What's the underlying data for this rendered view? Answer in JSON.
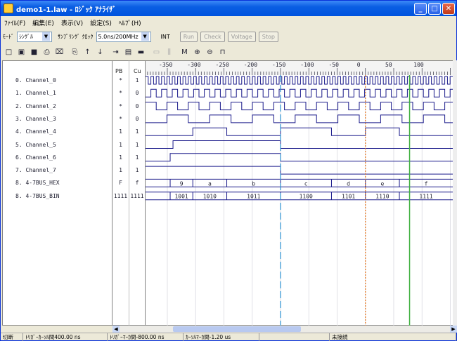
{
  "title": "demo1-1.law - ﾛｼﾞｯｸ ｱﾅﾗｲｻﾞ",
  "window_buttons": {
    "minimize": "_",
    "maximize": "□",
    "close": "✕"
  },
  "menu": [
    "ﾌｧｲﾙ(F)",
    "編集(E)",
    "表示(V)",
    "設定(S)",
    "ﾍﾙﾌﾟ(H)"
  ],
  "modebar": {
    "mode_label": "ﾓｰﾄﾞ",
    "mode_value": "ｼﾝｸﾞﾙ",
    "clock_label": "ｻﾝﾌﾟﾘﾝｸﾞ ｸﾛｯｸ",
    "clock_value": "5.0ns/200MHz",
    "int_label": "INT",
    "run": "Run",
    "check": "Check",
    "voltage": "Voltage",
    "stop": "Stop"
  },
  "toolbar_icons": [
    "new-file",
    "open-folder",
    "save",
    "print",
    "print-preview",
    "copy",
    "arrow-up",
    "arrow-down",
    "jump",
    "bars-chart",
    "red-bar",
    "disabled-1",
    "disabled-2",
    "marker-m",
    "zoom-in",
    "zoom-out",
    "pulse"
  ],
  "toolbar_glyphs": [
    "□",
    "▣",
    "■",
    "⎙",
    "⌧",
    "⎘",
    "↑",
    "↓",
    "⇥",
    "▤",
    "▬",
    "▭",
    "⫼",
    "M",
    "⊕",
    "⊖",
    "⊓"
  ],
  "columns": {
    "pb": "PB",
    "cu": "Cu"
  },
  "ruler_labels": [
    "-350",
    "-300",
    "-250",
    "-200",
    "-150",
    "-100",
    "-50",
    "0",
    "50",
    "100"
  ],
  "ruler_values": [
    -350,
    -300,
    -250,
    -200,
    -150,
    -100,
    -50,
    0,
    50,
    100
  ],
  "channels": [
    {
      "name": "0.  Channel_0",
      "pb": "*",
      "cu": "1"
    },
    {
      "name": "1.  Channel_1",
      "pb": "*",
      "cu": "0"
    },
    {
      "name": "2.  Channel_2",
      "pb": "*",
      "cu": "0"
    },
    {
      "name": "3.  Channel_3",
      "pb": "*",
      "cu": "0"
    },
    {
      "name": "4.  Channel_4",
      "pb": "1",
      "cu": "1"
    },
    {
      "name": "5.  Channel_5",
      "pb": "1",
      "cu": "1"
    },
    {
      "name": "6.  Channel_6",
      "pb": "1",
      "cu": "1"
    },
    {
      "name": "7.  Channel_7",
      "pb": "1",
      "cu": "1"
    },
    {
      "name": "8.  4-7BUS_HEX",
      "pb": "F",
      "cu": "f"
    },
    {
      "name": "8.  4-7BUS_BIN",
      "pb": "1111",
      "cu": "1111"
    }
  ],
  "hex_values": [
    "9",
    "a",
    "b",
    "c",
    "d",
    "e",
    "f"
  ],
  "bin_values": [
    "1001",
    "1010",
    "1011",
    "1100",
    "1101",
    "1110",
    "1111"
  ],
  "status": [
    "切断",
    "ﾄﾘｶﾞｰｶｰｿﾙ間400.00 ns",
    "ﾄﾘｶﾞｰﾏｰｶ間-800.00 ns",
    "ｶｰｿﾙﾏｰｶ間-1.20 us",
    "",
    "未接続"
  ],
  "colors": {
    "wave": "#1a1a8a",
    "cursor_blue": "#2a8fd0",
    "cursor_orange": "#e87820",
    "cursor_green": "#40b040",
    "grid": "#d8d8e0"
  }
}
